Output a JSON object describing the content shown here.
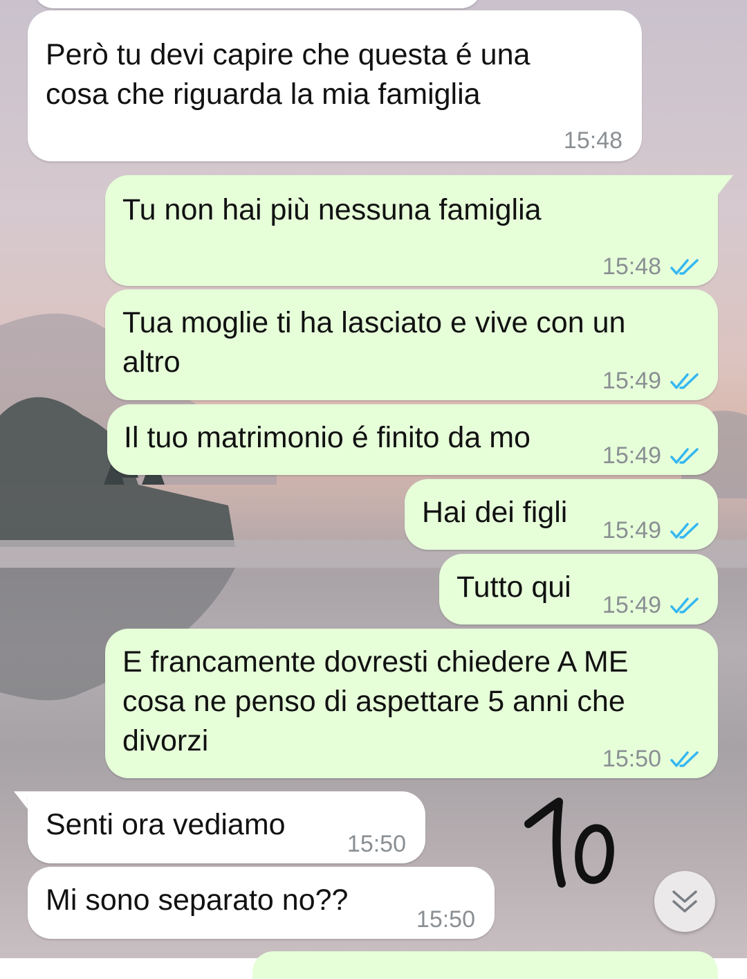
{
  "messages": [
    {
      "dir": "in",
      "text": "Però tu devi capire che questa é una\ncosa che riguarda la mia famiglia",
      "time": "15:48"
    },
    {
      "dir": "out",
      "text": "Tu non hai più nessuna famiglia",
      "time": "15:48",
      "status": "read"
    },
    {
      "dir": "out",
      "text": "Tua moglie ti ha lasciato e vive con un\naltro",
      "time": "15:49",
      "status": "read"
    },
    {
      "dir": "out",
      "text": "Il tuo matrimonio é finito da mo",
      "time": "15:49",
      "status": "read"
    },
    {
      "dir": "out",
      "text": "Hai dei figli",
      "time": "15:49",
      "status": "read"
    },
    {
      "dir": "out",
      "text": "Tutto qui",
      "time": "15:49",
      "status": "read"
    },
    {
      "dir": "out",
      "text": "E francamente dovresti chiedere A ME\ncosa ne penso di aspettare 5 anni che\ndivorzi",
      "time": "15:50",
      "status": "read"
    },
    {
      "dir": "in",
      "text": "Senti ora vediamo",
      "time": "15:50"
    },
    {
      "dir": "in",
      "text": "Mi sono separato no??",
      "time": "15:50"
    }
  ],
  "annotation": "10",
  "icons": {
    "read_receipt": "double-check-icon",
    "scroll_down": "chevron-double-down-icon"
  },
  "colors": {
    "incoming": "#ffffff",
    "outgoing": "#e6ffd9",
    "read_tick": "#34b7f1",
    "timestamp": "#8a8f93"
  }
}
